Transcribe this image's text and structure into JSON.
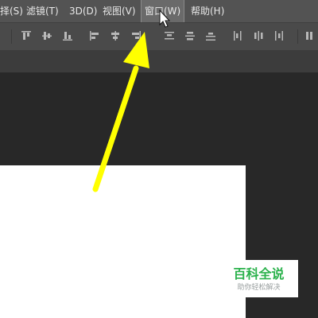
{
  "menubar": {
    "items": [
      {
        "label": "择(S)",
        "active": false
      },
      {
        "label": "滤镜(T)",
        "active": false
      },
      {
        "label": "3D(D)",
        "active": false
      },
      {
        "label": "视图(V)",
        "active": false
      },
      {
        "label": "窗口(W)",
        "active": true
      },
      {
        "label": "帮助(H)",
        "active": false
      }
    ]
  },
  "options_bar": {
    "icons": [
      "align-top-icon",
      "align-vertical-center-icon",
      "align-bottom-icon",
      "align-left-icon",
      "align-horizontal-center-icon",
      "align-right-icon",
      "distribute-top-icon",
      "distribute-vertical-center-icon",
      "distribute-bottom-icon",
      "distribute-left-icon",
      "distribute-horizontal-center-icon",
      "distribute-right-icon",
      "auto-align-icon"
    ]
  },
  "annotation": {
    "arrow_color": "#ffff00",
    "points_to": "窗口(W)"
  },
  "watermark": {
    "title": "百科全说",
    "subtitle": "助你轻松解决"
  },
  "colors": {
    "menubar_bg": "#535353",
    "options_bg": "#4a4a4a",
    "workspace_bg": "#282828",
    "watermark_green": "#2bb24c"
  }
}
